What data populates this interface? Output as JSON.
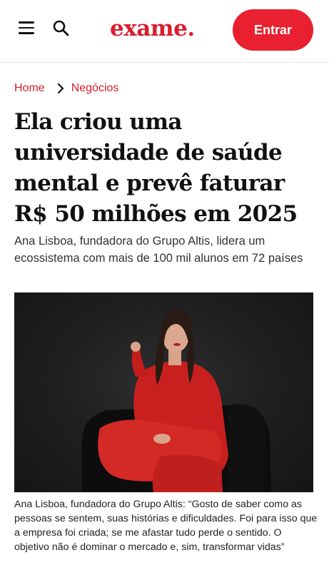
{
  "header": {
    "logo": "exame.",
    "login_label": "Entrar",
    "menu_icon": "hamburger-menu-icon",
    "search_icon": "search-icon",
    "brand_color": "#e8202f"
  },
  "breadcrumb": {
    "home": "Home",
    "separator_icon": "chevron-right-icon",
    "section": "Negócios"
  },
  "article": {
    "title": "Ela criou uma universidade de saúde mental e prevê faturar R$ 50 milhões em 2025",
    "subtitle": "Ana Lisboa, fundadora do Grupo Altis, lidera um ecossistema com mais de 100 mil alunos em 72 países",
    "image_caption": "Ana Lisboa, fundadora do Grupo Altis: “Gosto de saber como as pessoas se sentem, suas histórias e dificuldades. Foi para isso que a empresa foi criada; se me afastar tudo perde o sentido. O objetivo não é dominar o mercado e, sim, transformar vidas”"
  }
}
